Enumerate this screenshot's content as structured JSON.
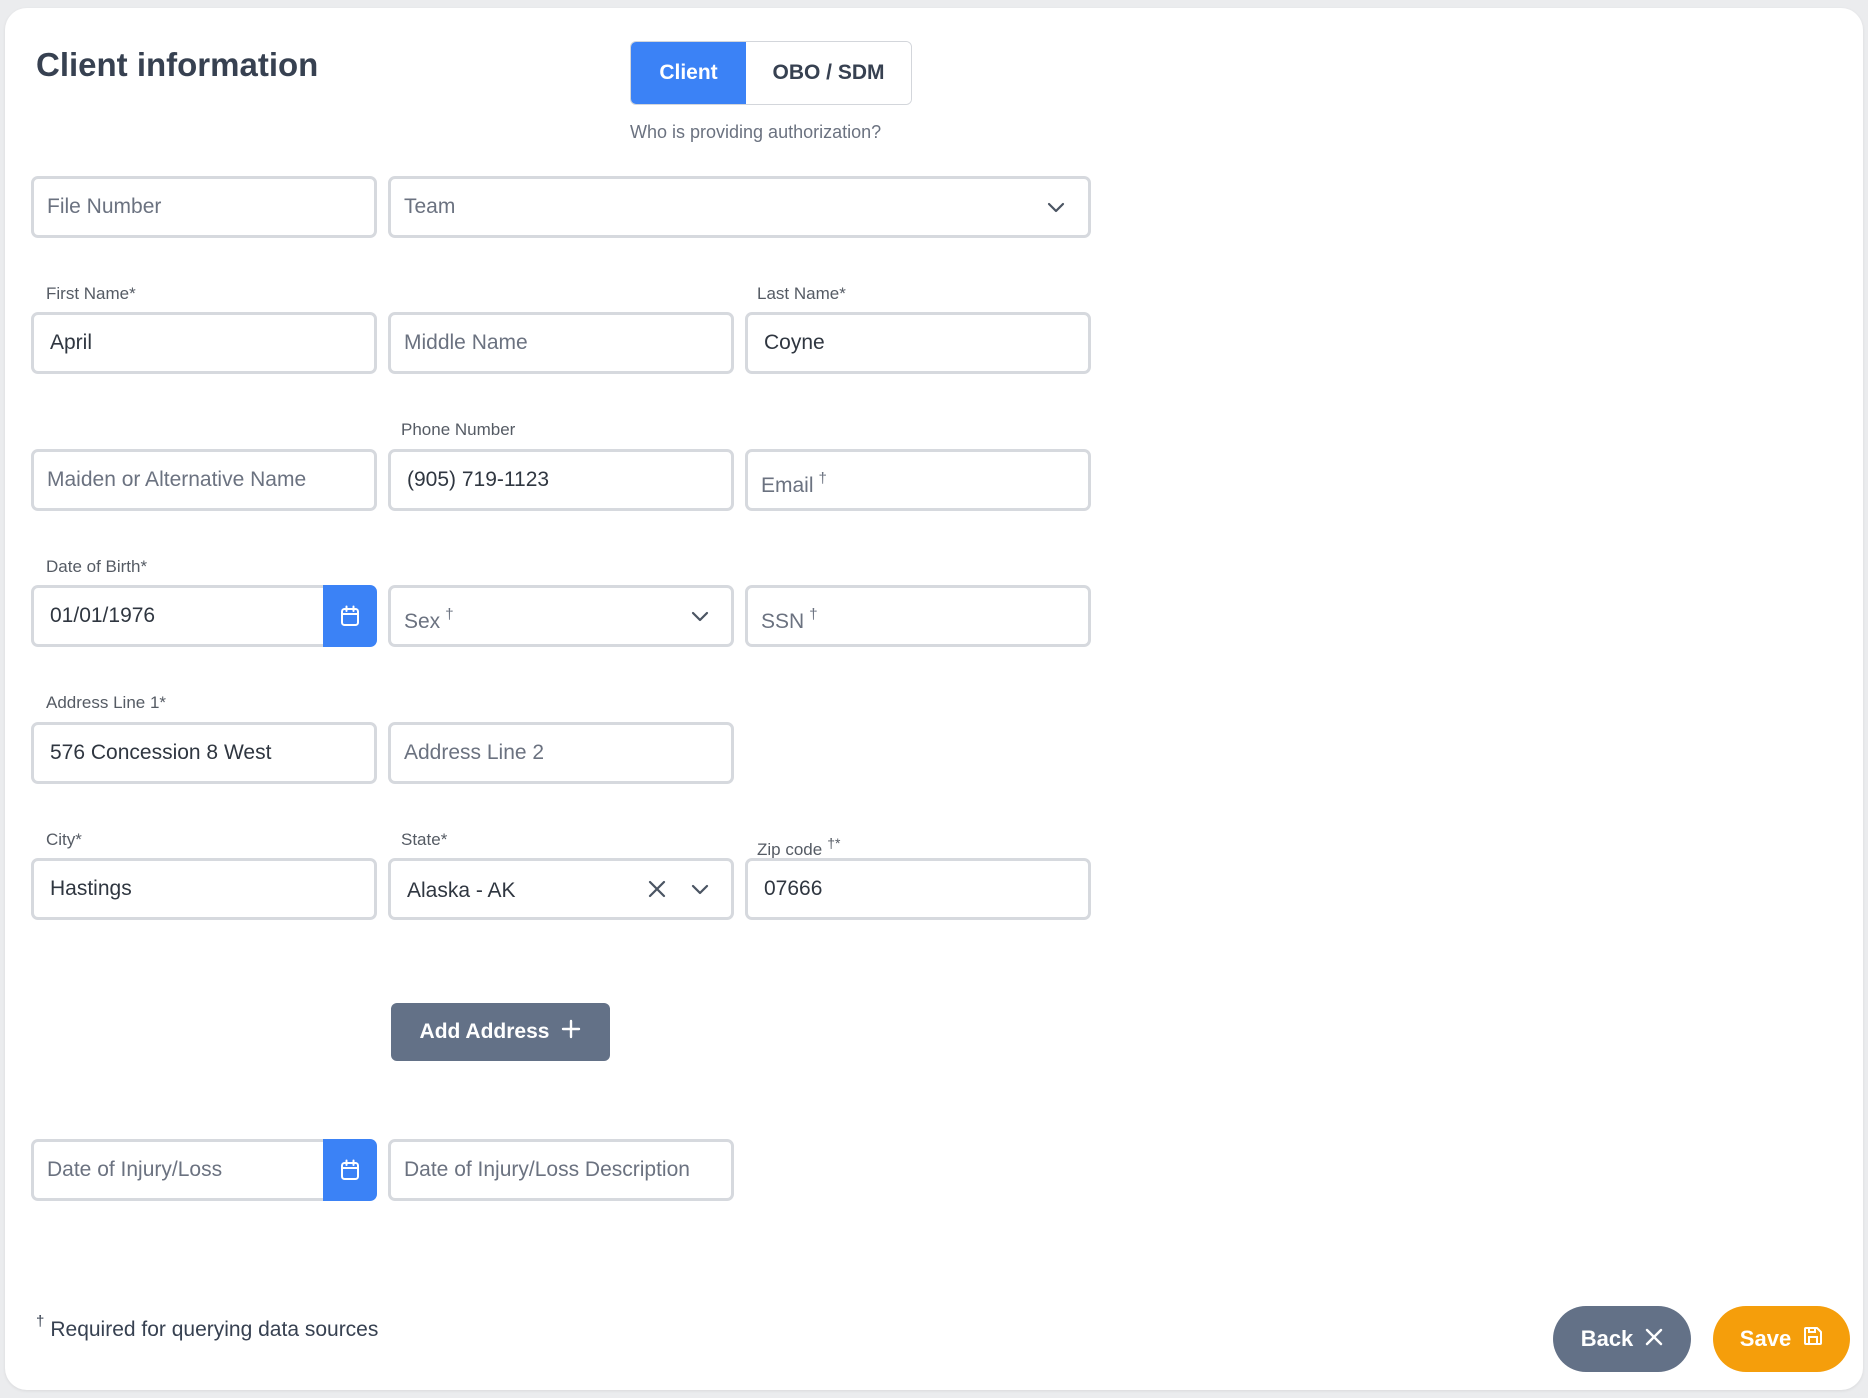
{
  "header": {
    "title": "Client information"
  },
  "authorization": {
    "options": [
      "Client",
      "OBO / SDM"
    ],
    "selected": "Client",
    "hint": "Who is providing authorization?"
  },
  "fields": {
    "file_number": {
      "placeholder": "File Number"
    },
    "team": {
      "placeholder": "Team"
    },
    "first_name": {
      "label": "First Name*",
      "value": "April"
    },
    "middle_name": {
      "placeholder": "Middle Name"
    },
    "last_name": {
      "label": "Last Name*",
      "value": "Coyne"
    },
    "maiden_name": {
      "placeholder": "Maiden or Alternative Name"
    },
    "phone": {
      "label": "Phone Number",
      "value": "(905) 719-1123"
    },
    "email": {
      "placeholder": "Email",
      "marker": "†"
    },
    "dob": {
      "label": "Date of Birth*",
      "value": "01/01/1976"
    },
    "sex": {
      "placeholder": "Sex",
      "marker": "†"
    },
    "ssn": {
      "placeholder": "SSN",
      "marker": "†"
    },
    "address1": {
      "label": "Address Line 1*",
      "value": "576 Concession 8 West"
    },
    "address2": {
      "placeholder": "Address Line 2"
    },
    "city": {
      "label": "City*",
      "value": "Hastings"
    },
    "state": {
      "label": "State*",
      "value": "Alaska - AK"
    },
    "zip": {
      "label": "Zip code",
      "label_marker": "†*",
      "value": "07666"
    },
    "injury_date": {
      "placeholder": "Date of Injury/Loss"
    },
    "injury_desc": {
      "placeholder": "Date of Injury/Loss Description"
    }
  },
  "actions": {
    "add_address": "Add Address",
    "back": "Back",
    "save": "Save"
  },
  "footnote": {
    "marker": "†",
    "text": "Required for querying data sources"
  },
  "colors": {
    "primary": "#3b82f6",
    "secondary": "#637187",
    "save": "#f59e0b"
  },
  "icons": {
    "calendar": "calendar-icon",
    "chevron": "chevron-down-icon",
    "clear": "close-icon",
    "plus": "plus-icon",
    "back": "close-icon",
    "save": "floppy-disk-icon"
  }
}
